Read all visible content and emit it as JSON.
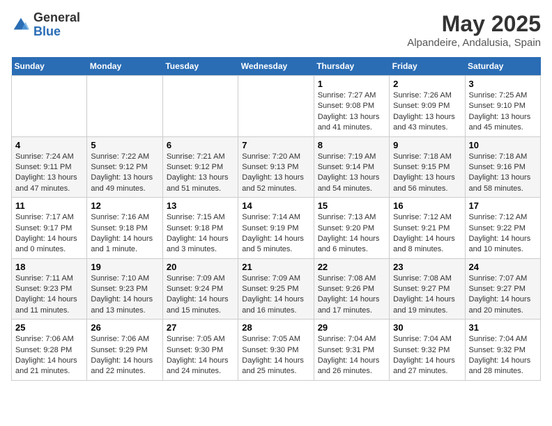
{
  "header": {
    "logo_general": "General",
    "logo_blue": "Blue",
    "title": "May 2025",
    "subtitle": "Alpandeire, Andalusia, Spain"
  },
  "calendar": {
    "days_of_week": [
      "Sunday",
      "Monday",
      "Tuesday",
      "Wednesday",
      "Thursday",
      "Friday",
      "Saturday"
    ],
    "weeks": [
      [
        {
          "day": "",
          "info": ""
        },
        {
          "day": "",
          "info": ""
        },
        {
          "day": "",
          "info": ""
        },
        {
          "day": "",
          "info": ""
        },
        {
          "day": "1",
          "info": "Sunrise: 7:27 AM\nSunset: 9:08 PM\nDaylight: 13 hours\nand 41 minutes."
        },
        {
          "day": "2",
          "info": "Sunrise: 7:26 AM\nSunset: 9:09 PM\nDaylight: 13 hours\nand 43 minutes."
        },
        {
          "day": "3",
          "info": "Sunrise: 7:25 AM\nSunset: 9:10 PM\nDaylight: 13 hours\nand 45 minutes."
        }
      ],
      [
        {
          "day": "4",
          "info": "Sunrise: 7:24 AM\nSunset: 9:11 PM\nDaylight: 13 hours\nand 47 minutes."
        },
        {
          "day": "5",
          "info": "Sunrise: 7:22 AM\nSunset: 9:12 PM\nDaylight: 13 hours\nand 49 minutes."
        },
        {
          "day": "6",
          "info": "Sunrise: 7:21 AM\nSunset: 9:12 PM\nDaylight: 13 hours\nand 51 minutes."
        },
        {
          "day": "7",
          "info": "Sunrise: 7:20 AM\nSunset: 9:13 PM\nDaylight: 13 hours\nand 52 minutes."
        },
        {
          "day": "8",
          "info": "Sunrise: 7:19 AM\nSunset: 9:14 PM\nDaylight: 13 hours\nand 54 minutes."
        },
        {
          "day": "9",
          "info": "Sunrise: 7:18 AM\nSunset: 9:15 PM\nDaylight: 13 hours\nand 56 minutes."
        },
        {
          "day": "10",
          "info": "Sunrise: 7:18 AM\nSunset: 9:16 PM\nDaylight: 13 hours\nand 58 minutes."
        }
      ],
      [
        {
          "day": "11",
          "info": "Sunrise: 7:17 AM\nSunset: 9:17 PM\nDaylight: 14 hours\nand 0 minutes."
        },
        {
          "day": "12",
          "info": "Sunrise: 7:16 AM\nSunset: 9:18 PM\nDaylight: 14 hours\nand 1 minute."
        },
        {
          "day": "13",
          "info": "Sunrise: 7:15 AM\nSunset: 9:18 PM\nDaylight: 14 hours\nand 3 minutes."
        },
        {
          "day": "14",
          "info": "Sunrise: 7:14 AM\nSunset: 9:19 PM\nDaylight: 14 hours\nand 5 minutes."
        },
        {
          "day": "15",
          "info": "Sunrise: 7:13 AM\nSunset: 9:20 PM\nDaylight: 14 hours\nand 6 minutes."
        },
        {
          "day": "16",
          "info": "Sunrise: 7:12 AM\nSunset: 9:21 PM\nDaylight: 14 hours\nand 8 minutes."
        },
        {
          "day": "17",
          "info": "Sunrise: 7:12 AM\nSunset: 9:22 PM\nDaylight: 14 hours\nand 10 minutes."
        }
      ],
      [
        {
          "day": "18",
          "info": "Sunrise: 7:11 AM\nSunset: 9:23 PM\nDaylight: 14 hours\nand 11 minutes."
        },
        {
          "day": "19",
          "info": "Sunrise: 7:10 AM\nSunset: 9:23 PM\nDaylight: 14 hours\nand 13 minutes."
        },
        {
          "day": "20",
          "info": "Sunrise: 7:09 AM\nSunset: 9:24 PM\nDaylight: 14 hours\nand 15 minutes."
        },
        {
          "day": "21",
          "info": "Sunrise: 7:09 AM\nSunset: 9:25 PM\nDaylight: 14 hours\nand 16 minutes."
        },
        {
          "day": "22",
          "info": "Sunrise: 7:08 AM\nSunset: 9:26 PM\nDaylight: 14 hours\nand 17 minutes."
        },
        {
          "day": "23",
          "info": "Sunrise: 7:08 AM\nSunset: 9:27 PM\nDaylight: 14 hours\nand 19 minutes."
        },
        {
          "day": "24",
          "info": "Sunrise: 7:07 AM\nSunset: 9:27 PM\nDaylight: 14 hours\nand 20 minutes."
        }
      ],
      [
        {
          "day": "25",
          "info": "Sunrise: 7:06 AM\nSunset: 9:28 PM\nDaylight: 14 hours\nand 21 minutes."
        },
        {
          "day": "26",
          "info": "Sunrise: 7:06 AM\nSunset: 9:29 PM\nDaylight: 14 hours\nand 22 minutes."
        },
        {
          "day": "27",
          "info": "Sunrise: 7:05 AM\nSunset: 9:30 PM\nDaylight: 14 hours\nand 24 minutes."
        },
        {
          "day": "28",
          "info": "Sunrise: 7:05 AM\nSunset: 9:30 PM\nDaylight: 14 hours\nand 25 minutes."
        },
        {
          "day": "29",
          "info": "Sunrise: 7:04 AM\nSunset: 9:31 PM\nDaylight: 14 hours\nand 26 minutes."
        },
        {
          "day": "30",
          "info": "Sunrise: 7:04 AM\nSunset: 9:32 PM\nDaylight: 14 hours\nand 27 minutes."
        },
        {
          "day": "31",
          "info": "Sunrise: 7:04 AM\nSunset: 9:32 PM\nDaylight: 14 hours\nand 28 minutes."
        }
      ]
    ]
  }
}
